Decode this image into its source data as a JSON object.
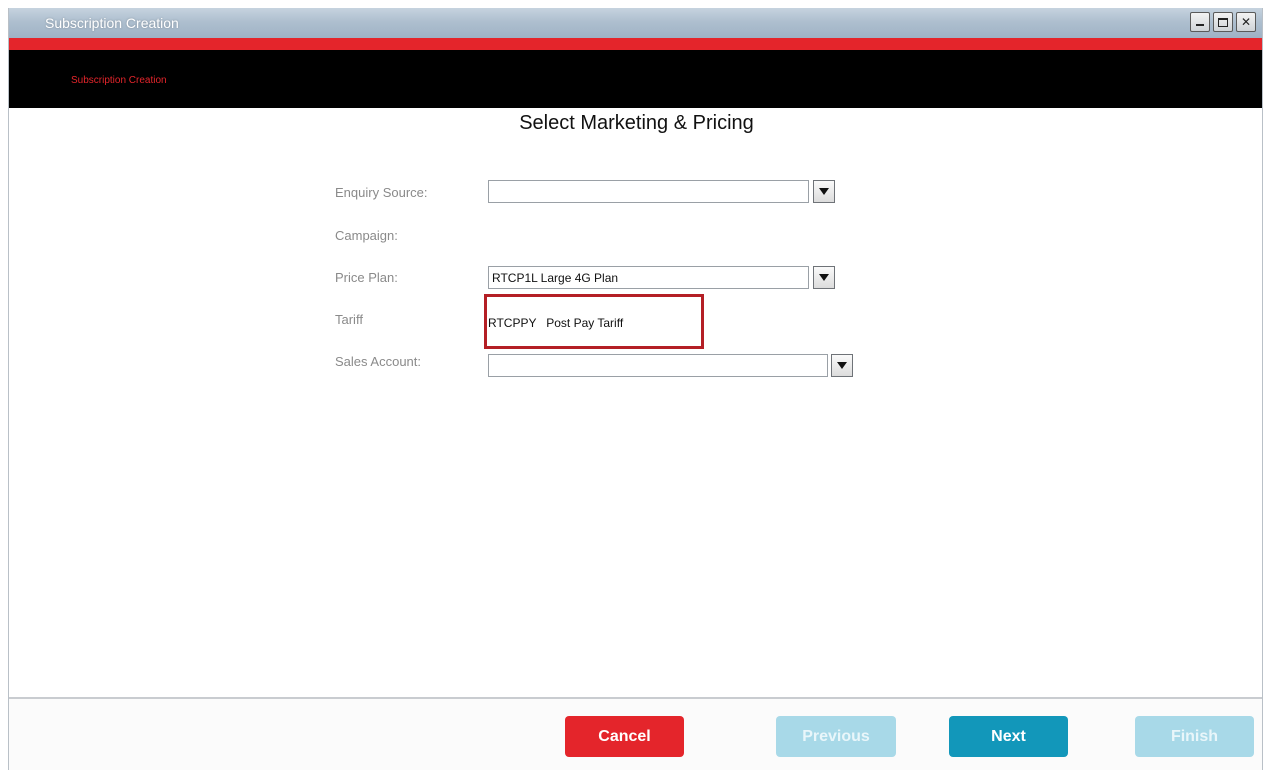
{
  "window": {
    "title": "Subscription Creation",
    "controls": [
      "minimize-icon",
      "maximize-icon",
      "close-icon"
    ],
    "close_glyph": "✕"
  },
  "banner": {
    "title": "Subscription Creation"
  },
  "page": {
    "title": "Select Marketing & Pricing"
  },
  "form": {
    "enquiry_source": {
      "label": "Enquiry Source:",
      "value": ""
    },
    "campaign": {
      "label": "Campaign:"
    },
    "price_plan": {
      "label": "Price Plan:",
      "value": "RTCP1L  Large 4G Plan"
    },
    "tariff": {
      "label": "Tariff",
      "value": "RTCPPY   Post Pay Tariff"
    },
    "sales_account": {
      "label": "Sales Account:",
      "value": ""
    }
  },
  "footer": {
    "cancel_label": "Cancel",
    "previous_label": "Previous",
    "next_label": "Next",
    "finish_label": "Finish"
  },
  "colors": {
    "accent_red": "#e4252b",
    "primary_blue": "#1297ba",
    "disabled_blue": "#a8d9e8",
    "highlight": "#b41f25"
  }
}
